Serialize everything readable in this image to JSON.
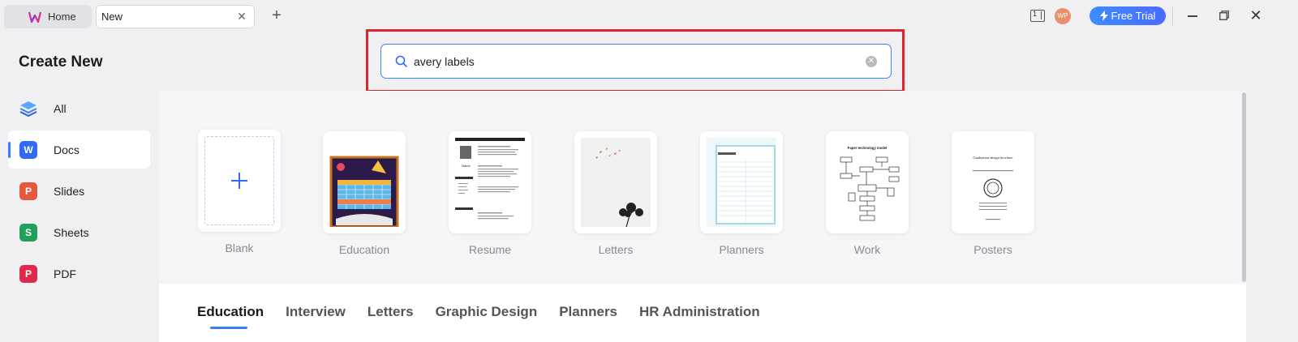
{
  "titlebar": {
    "home_tab": "Home",
    "new_tab": "New",
    "panel_badge": "1",
    "avatar_initials": "WP",
    "free_trial": "Free Trial"
  },
  "sidebar": {
    "title": "Create New",
    "items": [
      {
        "label": "All",
        "icon": "layers-icon"
      },
      {
        "label": "Docs",
        "icon": "docs-icon",
        "letter": "W"
      },
      {
        "label": "Slides",
        "icon": "slides-icon",
        "letter": "P"
      },
      {
        "label": "Sheets",
        "icon": "sheets-icon",
        "letter": "S"
      },
      {
        "label": "PDF",
        "icon": "pdf-icon",
        "letter": "P"
      }
    ],
    "active": "Docs"
  },
  "search": {
    "value": "avery labels",
    "placeholder": ""
  },
  "templates": [
    {
      "label": "Blank"
    },
    {
      "label": "Education"
    },
    {
      "label": "Resume"
    },
    {
      "label": "Letters"
    },
    {
      "label": "Planners"
    },
    {
      "label": "Work"
    },
    {
      "label": "Posters"
    }
  ],
  "template_thumbs": {
    "resume_name": "Name",
    "work_title": "Paper technology model",
    "poster_title": "Graduation design brochure"
  },
  "categories": [
    {
      "label": "Education"
    },
    {
      "label": "Interview"
    },
    {
      "label": "Letters"
    },
    {
      "label": "Graphic Design"
    },
    {
      "label": "Planners"
    },
    {
      "label": "HR Administration"
    }
  ],
  "colors": {
    "accent": "#3b7cff",
    "highlight": "#e1232a"
  }
}
